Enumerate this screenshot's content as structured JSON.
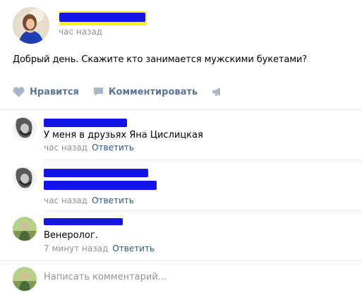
{
  "post": {
    "time": "час назад",
    "text": "Добрый день. Скажите кто занимается мужскими букетами?"
  },
  "actions": {
    "like_label": "Нравится",
    "comment_label": "Комментировать"
  },
  "comments": [
    {
      "text": "У меня в друзьях Яна Цислицкая",
      "time": "час назад",
      "reply_label": "Ответить"
    },
    {
      "text": "",
      "time": "час назад",
      "reply_label": "Ответить"
    },
    {
      "text": "Венеролог.",
      "time": "7 минут назад",
      "reply_label": "Ответить"
    }
  ],
  "composer": {
    "placeholder": "Написать комментарий..."
  },
  "colors": {
    "accent": "#2a5885",
    "action": "#5b7591",
    "muted": "#939393",
    "redaction": "#1414e6",
    "highlight": "#f3f315"
  }
}
